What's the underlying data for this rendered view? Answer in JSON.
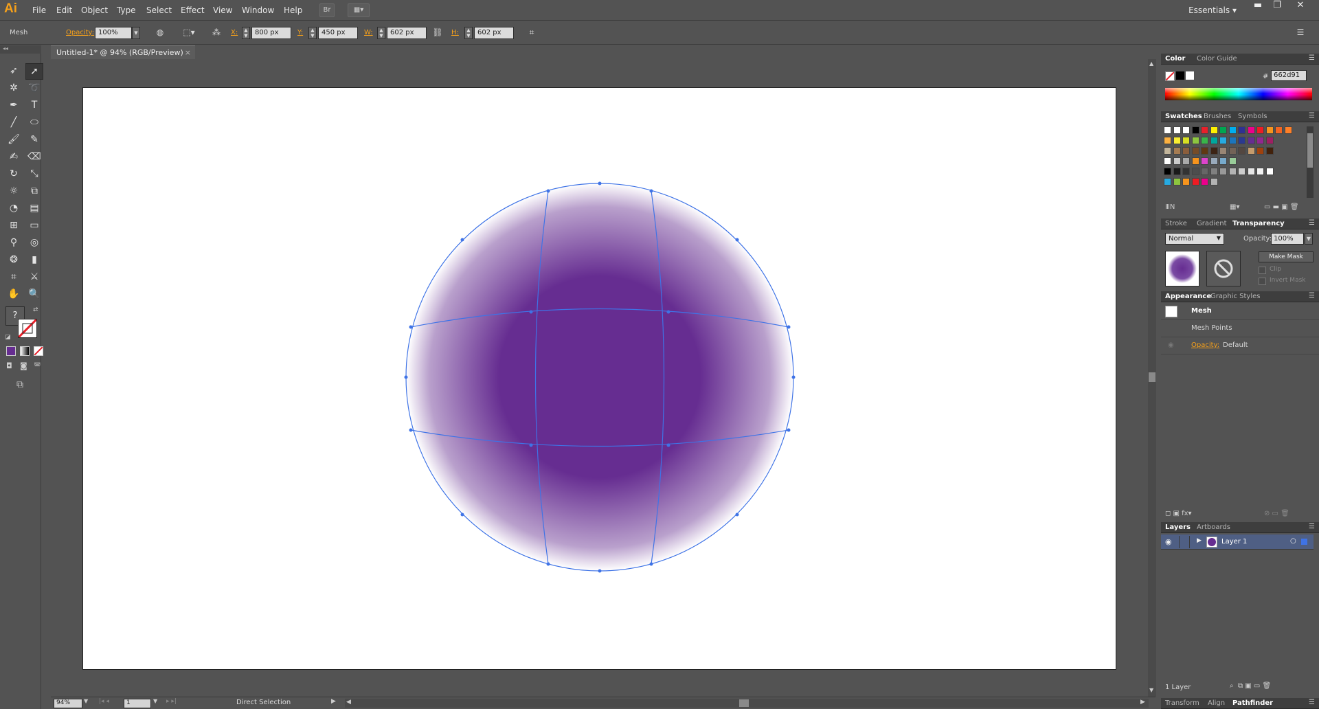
{
  "menu": {
    "logo": "Ai",
    "items": [
      "File",
      "Edit",
      "Object",
      "Type",
      "Select",
      "Effect",
      "View",
      "Window",
      "Help"
    ],
    "bridge_label": "Br",
    "workspace": "Essentials"
  },
  "control": {
    "object_type": "Mesh",
    "opacity_label": "Opacity:",
    "opacity_value": "100%",
    "x_label": "X:",
    "x_value": "800 px",
    "y_label": "Y:",
    "y_value": "450 px",
    "w_label": "W:",
    "w_value": "602 px",
    "h_label": "H:",
    "h_value": "602 px"
  },
  "document": {
    "tab_title": "Untitled-1* @ 94% (RGB/Preview)",
    "mesh_color": "#662d91"
  },
  "status": {
    "zoom": "94%",
    "artboard_num": "1",
    "tool_name": "Direct Selection"
  },
  "panels": {
    "color": {
      "tabs": [
        "Color",
        "Color Guide"
      ],
      "hex_label": "#",
      "hex_value": "662d91"
    },
    "swatches": {
      "tabs": [
        "Swatches",
        "Brushes",
        "Symbols"
      ]
    },
    "transparency": {
      "tabs": [
        "Stroke",
        "Gradient",
        "Transparency"
      ],
      "blend_mode": "Normal",
      "opacity_label": "Opacity:",
      "opacity_value": "100%",
      "make_mask": "Make Mask",
      "clip": "Clip",
      "invert_mask": "Invert Mask"
    },
    "appearance": {
      "tabs": [
        "Appearance",
        "Graphic Styles"
      ],
      "title": "Mesh",
      "mesh_points": "Mesh Points",
      "opacity_label": "Opacity:",
      "opacity_value": "Default"
    },
    "layers": {
      "tabs": [
        "Layers",
        "Artboards"
      ],
      "layer_name": "Layer 1",
      "count": "1 Layer"
    },
    "bottom_tabs": [
      "Transform",
      "Align",
      "Pathfinder"
    ]
  }
}
